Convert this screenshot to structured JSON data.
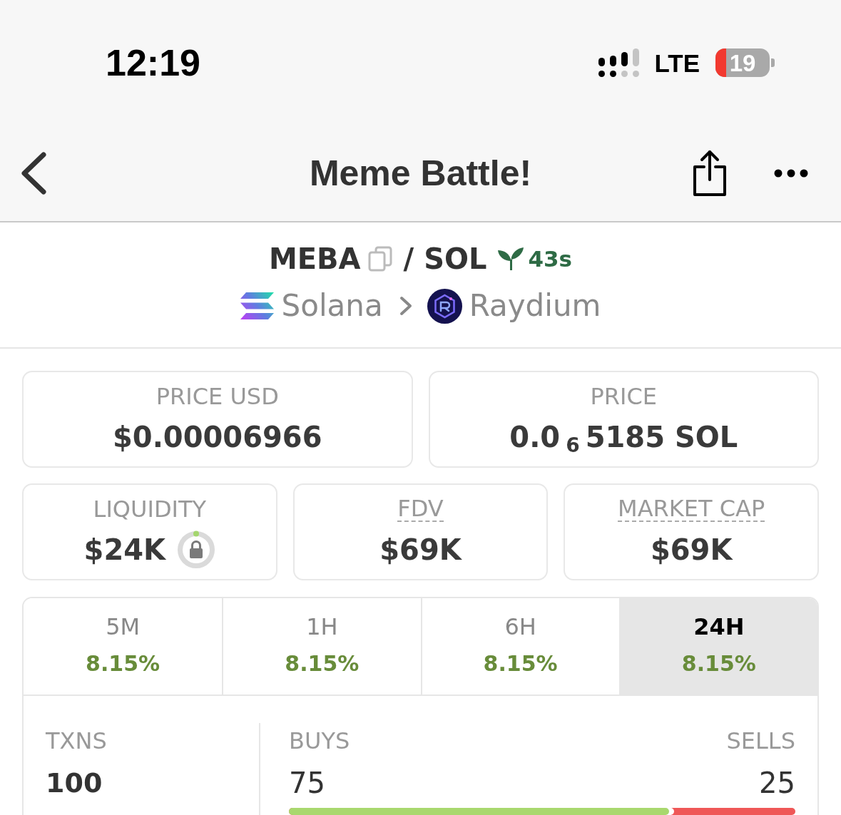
{
  "status_bar": {
    "time": "12:19",
    "network": "LTE",
    "battery": "19"
  },
  "nav_bar": {
    "title": "Meme Battle!"
  },
  "pair": {
    "base": "MEBA",
    "separator": "/",
    "quote": "SOL",
    "age": "43s",
    "chain": "Solana",
    "dex": "Raydium"
  },
  "price_cards": [
    {
      "label": "PRICE USD",
      "value": "$0.00006966"
    },
    {
      "label": "PRICE",
      "value": "0.0$_{6}$5185 SOL"
    }
  ],
  "stat_cards": [
    {
      "kind": "lock",
      "label": "LIQUIDITY",
      "value": "$24K"
    },
    {
      "kind": "tooltip",
      "label": "FDV",
      "value": "$69K"
    },
    {
      "kind": "tooltip",
      "label": "MARKET CAP",
      "value": "$69K"
    }
  ],
  "timeframes": [
    {
      "label": "5M",
      "change": "8.15%",
      "selected": false
    },
    {
      "label": "1H",
      "change": "8.15%",
      "selected": false
    },
    {
      "label": "6H",
      "change": "8.15%",
      "selected": false
    },
    {
      "label": "24H",
      "change": "8.15%",
      "selected": true
    }
  ],
  "transactions": {
    "label": "TXNS",
    "total": "100",
    "buys_label": "BUYS",
    "buys": "75",
    "sells_label": "SELLS",
    "sells": "25",
    "level": 0.75
  }
}
